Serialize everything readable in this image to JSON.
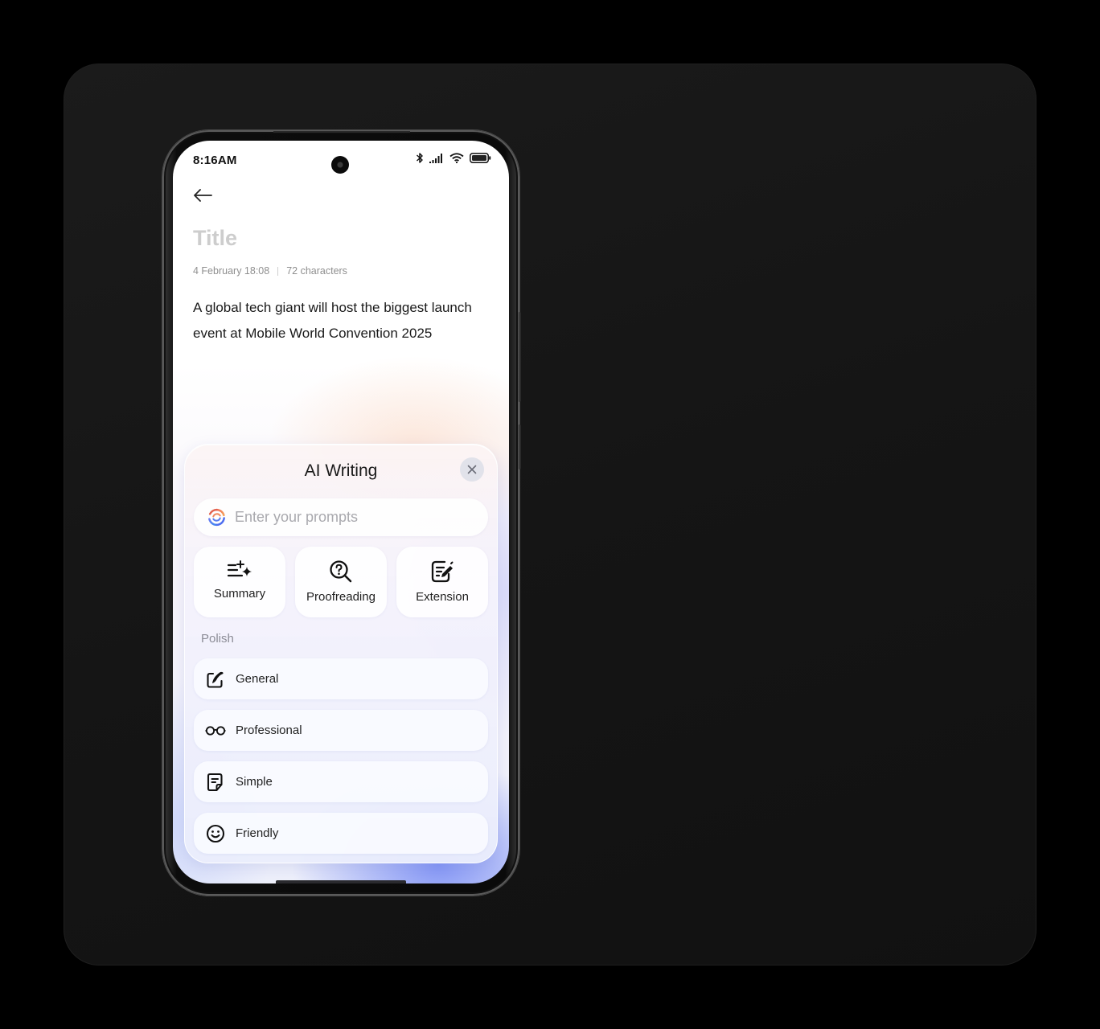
{
  "status_bar": {
    "time": "8:16AM",
    "icons": [
      "bluetooth-icon",
      "signal-icon",
      "wifi-icon",
      "battery-icon"
    ]
  },
  "note": {
    "back_icon": "arrow-left-icon",
    "title_placeholder": "Title",
    "date": "4 February 18:08",
    "char_count": "72 characters",
    "body": "A global tech giant will host the biggest launch event at Mobile World Convention 2025"
  },
  "ai_writing": {
    "title": "AI Writing",
    "close_icon": "close-icon",
    "prompt": {
      "value": "",
      "placeholder": "Enter your prompts",
      "icon": "ai-swirl-icon"
    },
    "quick_actions": [
      {
        "label": "Summary",
        "icon": "summary-sparkle-icon"
      },
      {
        "label": "Proofreading",
        "icon": "search-question-icon"
      },
      {
        "label": "Extension",
        "icon": "edit-document-icon"
      }
    ],
    "polish": {
      "label": "Polish",
      "items": [
        {
          "label": "General",
          "icon": "pen-square-icon"
        },
        {
          "label": "Professional",
          "icon": "glasses-icon"
        },
        {
          "label": "Simple",
          "icon": "document-icon"
        },
        {
          "label": "Friendly",
          "icon": "smiley-icon"
        }
      ]
    }
  },
  "colors": {
    "panel_bg": "#161616",
    "screen_bg": "#ffffff",
    "accent_blue": "#7b8cf5",
    "accent_peach": "#fcd6be",
    "text_primary": "#1a1a1a",
    "text_muted": "#8f8f8f"
  }
}
